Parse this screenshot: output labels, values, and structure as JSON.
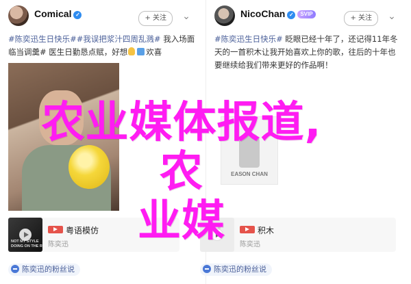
{
  "colors": {
    "tag_link": "#4a5f99",
    "overlay_text": "#ff1cf2",
    "verified_badge": "#2f8cf0",
    "song_badge": "#e5534b"
  },
  "left_post": {
    "username": "Comical",
    "verified_icon": "verified-check-icon",
    "follow_label": "+ 关注",
    "more_label": "⌄",
    "text_parts": {
      "tag1": "#陈奕迅生日快乐#",
      "tag2": "#我误把浆汁四周乱溅#",
      "plain1": " 我入场面",
      "plain2": "临当调羹#",
      "plain3": " 医生日勤恳点赋，好想",
      "plain4": "欢喜"
    },
    "music": {
      "cover_text": "NOT MY STYLE\nDOING ON THE RELEASE",
      "song_title": "粤语模仿",
      "artist": "陈奕迅"
    },
    "fan_link": "陈奕迅的粉丝说"
  },
  "right_post": {
    "username": "NicoChan",
    "verified_icon": "verified-check-icon",
    "vip_badge": "SVIP",
    "follow_label": "+ 关注",
    "more_label": "⌄",
    "text_parts": {
      "tag1": "#陈奕迅生日快乐#",
      "plain1": " 眨眼已经十年了，还记得11年冬",
      "plain2": "天的一首积木让我开始喜欢上你的歌，往后的十年也",
      "plain3": "要继续给我们带来更好的作品啊！"
    },
    "album_caption": "EASON CHAN",
    "music": {
      "song_title": "积木",
      "artist": "陈奕迅"
    },
    "fan_link": "陈奕迅的粉丝说"
  },
  "overlay": {
    "line1": "农业媒体报道,农",
    "line2": "业媒"
  }
}
